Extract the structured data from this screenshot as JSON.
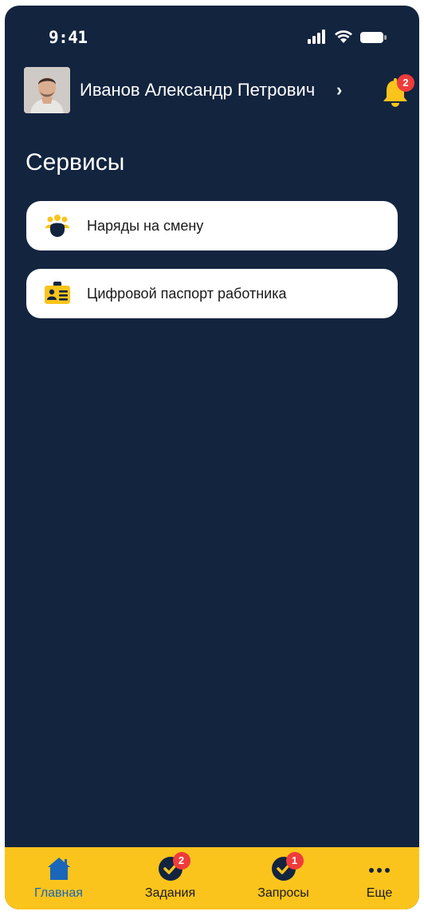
{
  "status_bar": {
    "time": "9:41",
    "icons": [
      "signal-icon",
      "wifi-icon",
      "battery-icon"
    ]
  },
  "header": {
    "user_name": "Иванов Александр Петрович",
    "chevron": "›",
    "notifications_badge": "2"
  },
  "section": {
    "title": "Сервисы"
  },
  "services": [
    {
      "label": "Наряды на смену",
      "icon": "team-icon"
    },
    {
      "label": "Цифровой паспорт работника",
      "icon": "id-card-icon"
    }
  ],
  "tabbar": {
    "tabs": [
      {
        "label": "Главная",
        "icon": "home-icon",
        "active": true
      },
      {
        "label": "Задания",
        "icon": "check-circle-icon",
        "badge": "2"
      },
      {
        "label": "Запросы",
        "icon": "check-circle-icon",
        "badge": "1"
      },
      {
        "label": "Еще",
        "icon": "more-dots-icon"
      }
    ]
  },
  "colors": {
    "background": "#13243f",
    "accent": "#fbc41c",
    "badge": "#ef3b3b",
    "active_tab": "#1a66b8",
    "card": "#ffffff"
  }
}
